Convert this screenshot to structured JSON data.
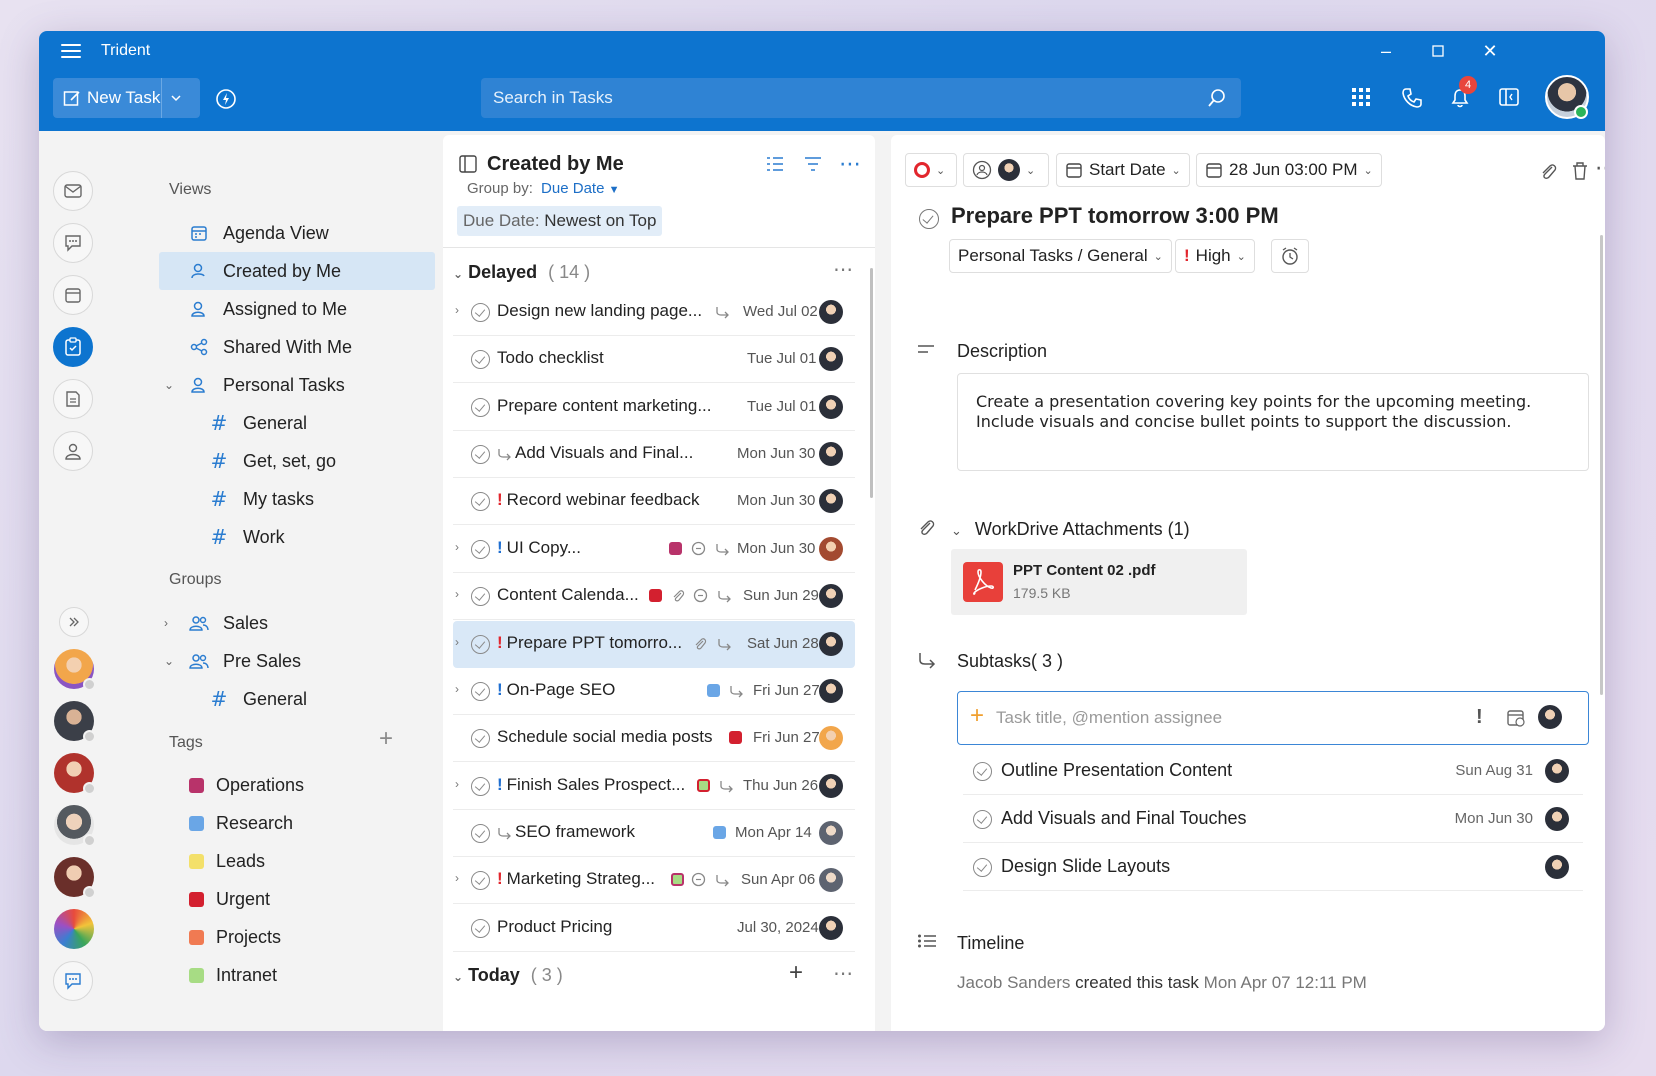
{
  "app": {
    "title": "Trident"
  },
  "toolbar": {
    "new_task": "New Task",
    "search_placeholder": "Search in Tasks",
    "notification_count": "4"
  },
  "sidebar": {
    "views_title": "Views",
    "views": [
      {
        "label": "Agenda View"
      },
      {
        "label": "Created by Me"
      },
      {
        "label": "Assigned to Me"
      },
      {
        "label": "Shared With Me"
      },
      {
        "label": "Personal Tasks"
      },
      {
        "label": "General"
      },
      {
        "label": "Get, set, go"
      },
      {
        "label": "My tasks"
      },
      {
        "label": "Work"
      }
    ],
    "groups_title": "Groups",
    "groups": [
      {
        "label": "Sales"
      },
      {
        "label": "Pre Sales"
      },
      {
        "label": "General"
      }
    ],
    "tags_title": "Tags",
    "tags": [
      {
        "label": "Operations",
        "color": "#b8336a"
      },
      {
        "label": "Research",
        "color": "#6aa6e6"
      },
      {
        "label": "Leads",
        "color": "#f3e06a"
      },
      {
        "label": "Urgent",
        "color": "#d3202f"
      },
      {
        "label": "Projects",
        "color": "#f07a52"
      },
      {
        "label": "Intranet",
        "color": "#a7dc84"
      }
    ]
  },
  "list": {
    "title": "Created by Me",
    "group_by_label": "Group by:",
    "group_by_value": "Due Date",
    "sort_prefix": "Due Date:",
    "sort_value": "Newest on Top",
    "delayed_title": "Delayed",
    "delayed_count": "( 14 )",
    "today_title": "Today",
    "today_count": "( 3 )",
    "tasks": [
      {
        "title": "Design new landing page...",
        "due": "Wed Jul 02"
      },
      {
        "title": "Todo checklist",
        "due": "Tue Jul 01"
      },
      {
        "title": "Prepare content marketing...",
        "due": "Tue Jul 01"
      },
      {
        "title": "Add Visuals and Final...",
        "due": "Mon Jun 30"
      },
      {
        "title": "Record webinar feedback",
        "due": "Mon Jun 30"
      },
      {
        "title": "UI Copy...",
        "due": "Mon Jun 30"
      },
      {
        "title": "Content Calenda...",
        "due": "Sun Jun 29"
      },
      {
        "title": "Prepare PPT tomorro...",
        "due": "Sat Jun 28"
      },
      {
        "title": "On-Page SEO",
        "due": "Fri Jun 27"
      },
      {
        "title": "Schedule social media posts",
        "due": "Fri Jun 27"
      },
      {
        "title": "Finish Sales Prospect...",
        "due": "Thu Jun 26"
      },
      {
        "title": "SEO framework",
        "due": "Mon Apr 14"
      },
      {
        "title": "Marketing Strateg...",
        "due": "Sun Apr 06"
      },
      {
        "title": "Product Pricing",
        "due": "Jul 30, 2024"
      }
    ]
  },
  "detail": {
    "start_date": "Start Date",
    "due_datetime": "28 Jun 03:00 PM",
    "title": "Prepare PPT tomorrow 3:00 PM",
    "project_path": "Personal Tasks  /  General",
    "priority": "High",
    "description_label": "Description",
    "description": "Create a presentation covering key points for the upcoming meeting. Include visuals and concise bullet points to support the discussion.",
    "attachments_label": "WorkDrive Attachments",
    "attachments_count": "(1)",
    "attachment": {
      "name": "PPT Content 02 .pdf",
      "size": "179.5 KB"
    },
    "subtasks_label": "Subtasks( 3 )",
    "subtask_placeholder": "Task title, @mention assignee",
    "subtasks": [
      {
        "title": "Outline Presentation Content",
        "due": "Sun Aug 31"
      },
      {
        "title": "Add Visuals and Final Touches",
        "due": "Mon Jun 30"
      },
      {
        "title": "Design Slide Layouts",
        "due": ""
      }
    ],
    "timeline_label": "Timeline",
    "timeline_entry": {
      "user": "Jacob Sanders",
      "action": "created this task",
      "time": "Mon Apr 07 12:11 PM"
    }
  }
}
